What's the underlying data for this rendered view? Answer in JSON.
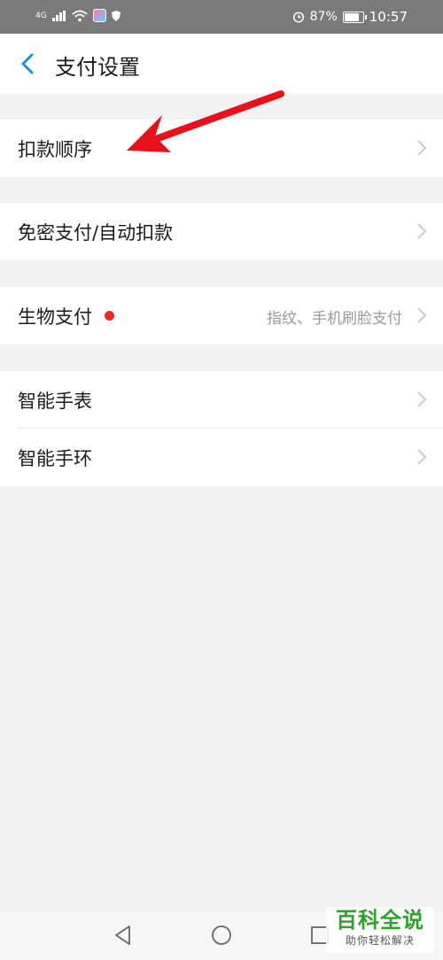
{
  "status_bar": {
    "network": "4G",
    "battery": "87%",
    "battery_level": 0.87,
    "time": "10:57"
  },
  "header": {
    "title": "支付设置",
    "back_icon": "chevron-left-icon"
  },
  "groups": [
    {
      "items": [
        {
          "label": "扣款顺序"
        }
      ]
    },
    {
      "items": [
        {
          "label": "免密支付/自动扣款"
        }
      ]
    },
    {
      "items": [
        {
          "label": "生物支付",
          "hint": "指纹、手机刷脸支付",
          "has_red_dot": true
        }
      ]
    },
    {
      "items": [
        {
          "label": "智能手表"
        },
        {
          "label": "智能手环"
        }
      ]
    }
  ],
  "nav_bar": {
    "buttons": [
      "back-icon",
      "home-icon",
      "recents-icon"
    ]
  },
  "watermark": {
    "title": "百科全说",
    "subtitle": "助你轻松解决"
  },
  "colors": {
    "accent": "#1f8fd8",
    "arrow": "#e8101a",
    "badge": "#e0302a",
    "watermark_green": "#2ea12b"
  }
}
